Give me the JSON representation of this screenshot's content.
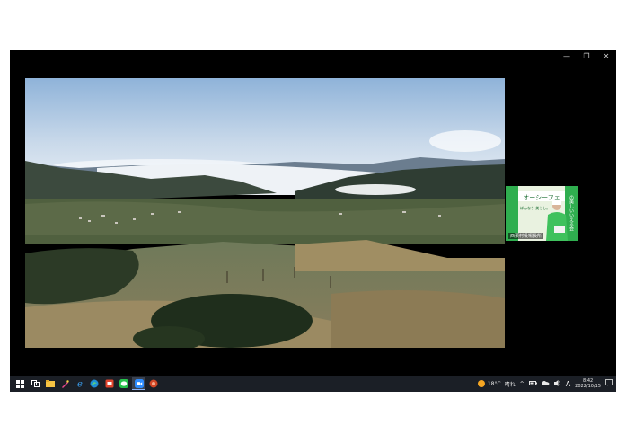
{
  "window": {
    "controls": {
      "minimize": "—",
      "maximize": "❐",
      "close": "✕"
    }
  },
  "thumbnail": {
    "label": "西栗村役場長所",
    "banner_text": "オーシーフェ",
    "side_text": "の美しいいえる会",
    "sign_text": "ぱんなり 美らし。"
  },
  "taskbar": {
    "apps": [
      "start-icon",
      "task-view-icon",
      "file-explorer-icon",
      "paint-icon",
      "edge-icon",
      "edge-browser-icon",
      "media-icon",
      "line-icon",
      "zoom-icon",
      "powerpoint-icon"
    ],
    "weather_temp": "18°C",
    "weather_desc": "晴れ",
    "ime_indicator": "A",
    "time": "8:42",
    "date": "2022/10/15"
  },
  "colors": {
    "taskbar_bg": "#1b1f26",
    "accent": "#8ab4f8",
    "sun": "#f5a623"
  }
}
